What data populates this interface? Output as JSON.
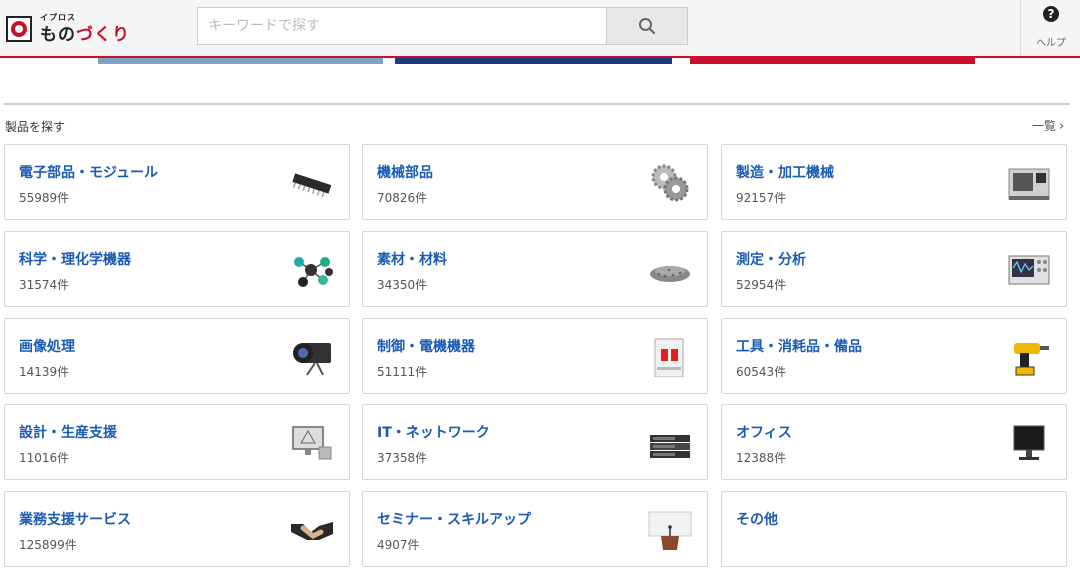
{
  "header": {
    "logo_small": "イプロス",
    "logo_big_a": "もの",
    "logo_big_b": "づくり",
    "search_placeholder": "キーワードで探す",
    "help_label": "ヘルプ"
  },
  "section": {
    "title": "製品を探す",
    "list_link": "一覧"
  },
  "categories": [
    {
      "name": "電子部品・モジュール",
      "count": "55989件",
      "icon": "ic-chip-icon"
    },
    {
      "name": "機械部品",
      "count": "70826件",
      "icon": "gear-icon"
    },
    {
      "name": "製造・加工機械",
      "count": "92157件",
      "icon": "machine-tool-icon"
    },
    {
      "name": "科学・理化学機器",
      "count": "31574件",
      "icon": "molecule-icon"
    },
    {
      "name": "素材・材料",
      "count": "34350件",
      "icon": "granules-icon"
    },
    {
      "name": "測定・分析",
      "count": "52954件",
      "icon": "oscilloscope-icon"
    },
    {
      "name": "画像処理",
      "count": "14139件",
      "icon": "camera-icon"
    },
    {
      "name": "制御・電機機器",
      "count": "51111件",
      "icon": "breaker-icon"
    },
    {
      "name": "工具・消耗品・備品",
      "count": "60543件",
      "icon": "drill-icon"
    },
    {
      "name": "設計・生産支援",
      "count": "11016件",
      "icon": "cad-monitor-icon"
    },
    {
      "name": "IT・ネットワーク",
      "count": "37358件",
      "icon": "server-icon"
    },
    {
      "name": "オフィス",
      "count": "12388件",
      "icon": "monitor-icon"
    },
    {
      "name": "業務支援サービス",
      "count": "125899件",
      "icon": "handshake-icon"
    },
    {
      "name": "セミナー・スキルアップ",
      "count": "4907件",
      "icon": "podium-icon"
    },
    {
      "name": "その他",
      "count": "",
      "icon": ""
    }
  ]
}
